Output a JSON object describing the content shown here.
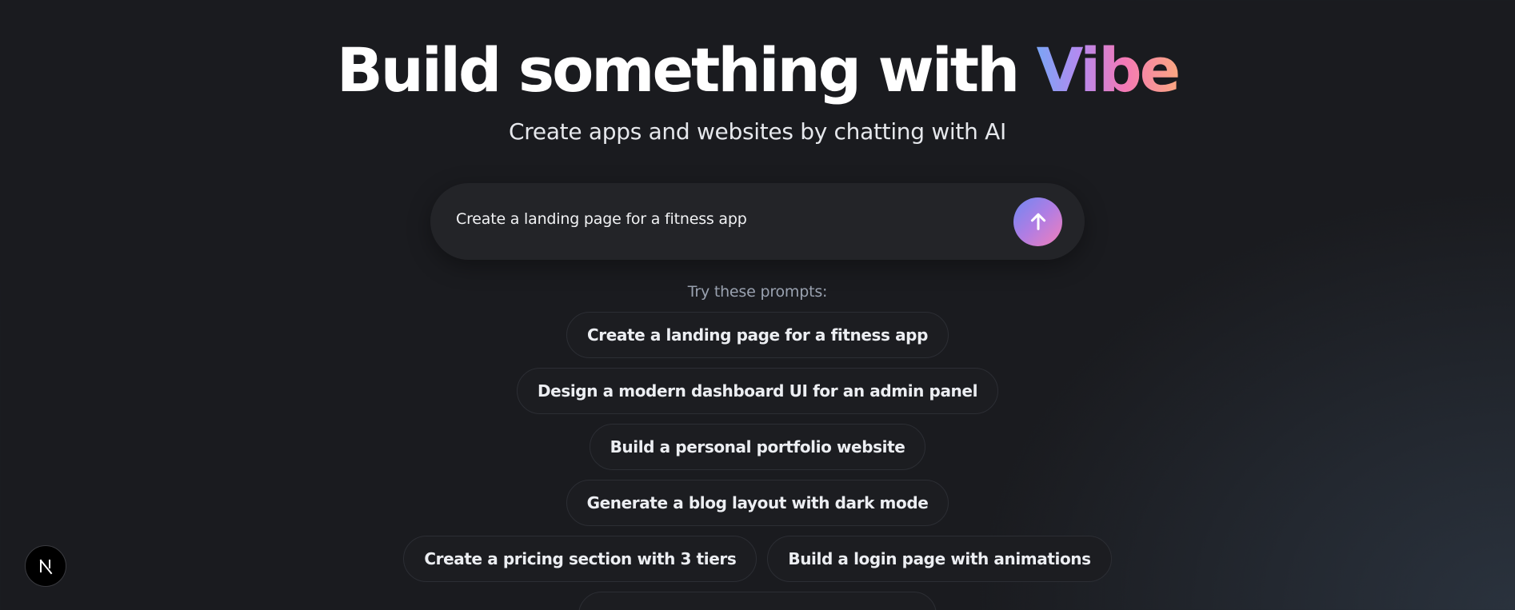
{
  "hero": {
    "title_main": "Build something with ",
    "title_accent": "Vibe",
    "subtitle": "Create apps and websites by chatting with AI"
  },
  "chat": {
    "input_value": "Create a landing page for a fitness app",
    "send_icon": "arrow-up-icon"
  },
  "prompts": {
    "label": "Try these prompts:",
    "rows": [
      [
        "Create a landing page for a fitness app"
      ],
      [
        "Design a modern dashboard UI for an admin panel"
      ],
      [
        "Build a personal portfolio website"
      ],
      [
        "Generate a blog layout with dark mode"
      ],
      [
        "Create a pricing section with 3 tiers",
        "Build a login page with animations"
      ]
    ]
  },
  "dev_badge": {
    "icon": "nextjs-logo-icon"
  },
  "colors": {
    "background": "#1a1b1f",
    "chat_box": "#232428",
    "accent_gradient": [
      "#7aa5f5",
      "#b48af0",
      "#f479b6",
      "#fba781"
    ],
    "send_gradient": [
      "#6f88f2",
      "#b07de3",
      "#f27fba"
    ]
  }
}
